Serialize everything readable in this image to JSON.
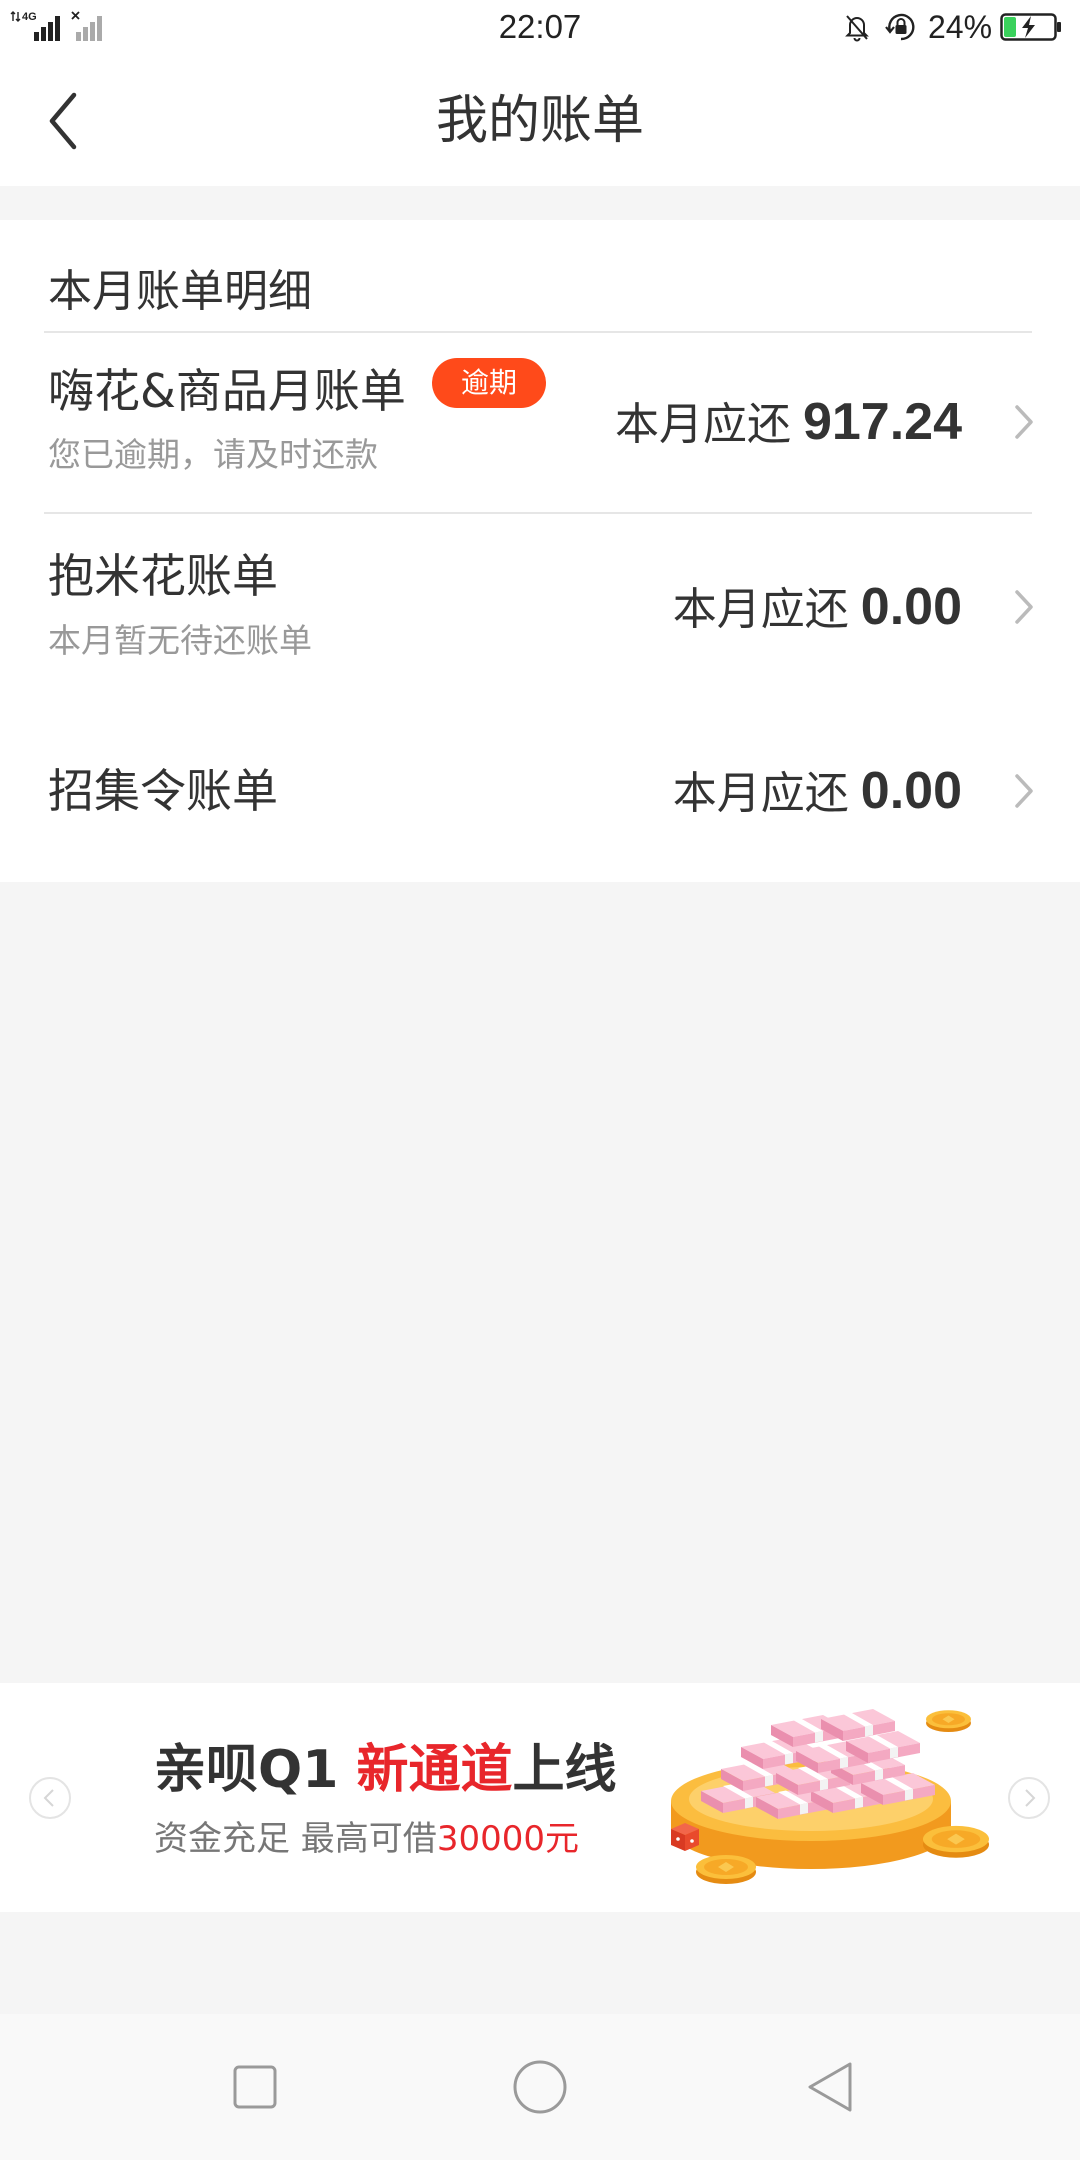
{
  "status_bar": {
    "time": "22:07",
    "network": "4G",
    "battery": {
      "label": "24%",
      "level": 24
    },
    "icons": [
      "signal-4g-icon",
      "no-signal-icon",
      "mute-bell-icon",
      "rotation-lock-icon",
      "battery-charging-icon"
    ]
  },
  "header": {
    "title": "我的账单",
    "back_icon": "back-icon"
  },
  "bills_section": {
    "title": "本月账单明细",
    "items": [
      {
        "name": "嗨花&商品月账单",
        "badge": "逾期",
        "subtitle": "您已逾期，请及时还款",
        "due_label": "本月应还",
        "amount": "917.24"
      },
      {
        "name": "抱米花账单",
        "subtitle": "本月暂无待还账单",
        "due_label": "本月应还",
        "amount": "0.00"
      },
      {
        "name": "招集令账单",
        "due_label": "本月应还",
        "amount": "0.00"
      }
    ],
    "row_icon": "chevron-right-icon"
  },
  "banner": {
    "title": {
      "prefix": "亲呗Q1 ",
      "highlight": "新通道",
      "suffix": "上线"
    },
    "subtitle": {
      "prefix": "资金充足 最高可借",
      "highlight": "30000元"
    },
    "icons": [
      "prev-circle-icon",
      "next-circle-icon",
      "money-illustration"
    ]
  },
  "nav_bar": {
    "icons": [
      "recent-apps-icon",
      "home-icon",
      "back-triangle-icon"
    ]
  },
  "colors": {
    "background": "#f5f5f5",
    "text_primary": "#333333",
    "text_secondary": "#999999",
    "badge": "#ff4a1a",
    "highlight_red": "#e8262b",
    "divider": "#e6e6e6"
  }
}
